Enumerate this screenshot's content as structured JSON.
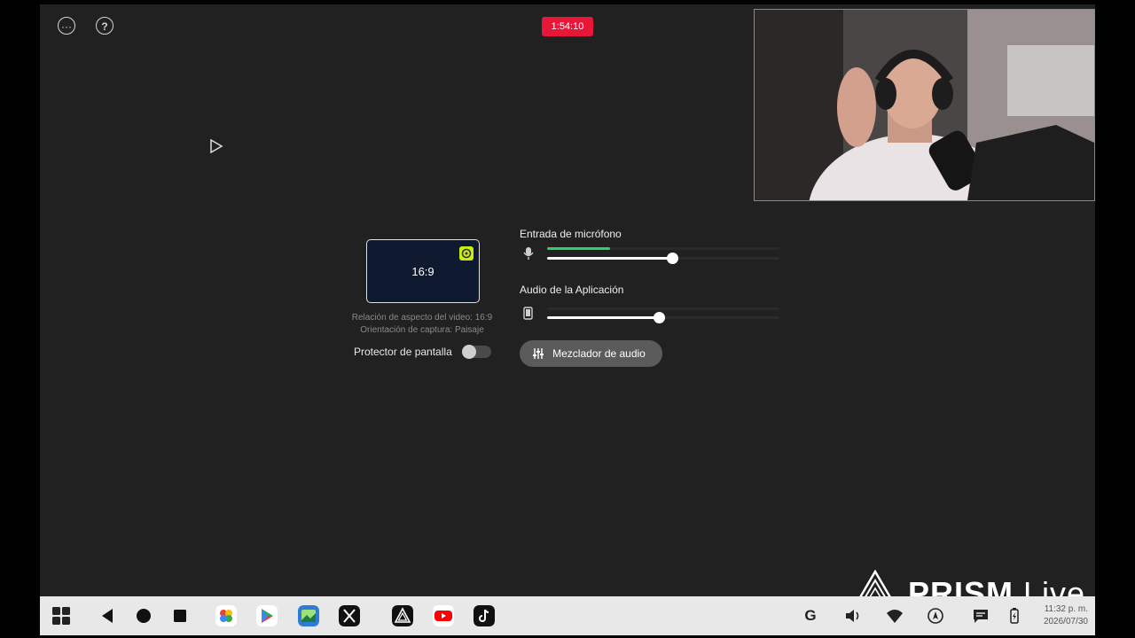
{
  "recording": {
    "timer": "1:54:10"
  },
  "top_icons": {
    "more": "more-icon",
    "help": "help-icon"
  },
  "aspect": {
    "label": "16:9",
    "ratio_text": "Relación de aspecto del video: 16:9",
    "orientation_text": "Orientación de captura: Paisaje"
  },
  "screen_saver": {
    "label": "Protector de pantalla",
    "enabled": false
  },
  "audio": {
    "mic": {
      "label": "Entrada de micrófono",
      "level": 0.27,
      "volume": 0.54
    },
    "app": {
      "label": "Audio de la Aplicación",
      "volume": 0.48
    },
    "mixer_button": "Mezclador de audio"
  },
  "branding": {
    "bold": "PRISM",
    "light": "Live"
  },
  "taskbar": {
    "clock_time": "11:32 p. m.",
    "clock_date": "2026/07/30",
    "system_g": "G"
  },
  "colors": {
    "record": "#e8173a",
    "mic_level": "#2ed26c",
    "accent": "#c6ee14"
  }
}
